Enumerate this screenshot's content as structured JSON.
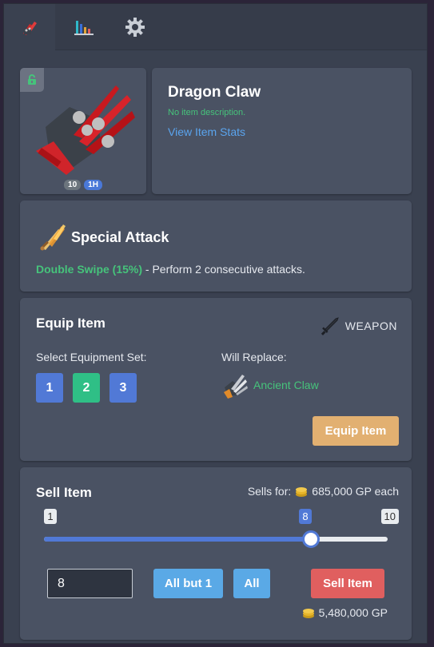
{
  "tabs": [
    {
      "name": "bank",
      "icon": "bank-icon",
      "active": true
    },
    {
      "name": "stats",
      "icon": "bar-chart-icon",
      "active": false
    },
    {
      "name": "settings",
      "icon": "gear-icon",
      "active": false
    }
  ],
  "item": {
    "name": "Dragon Claw",
    "description": "No item description.",
    "view_stats_label": "View Item Stats",
    "quantity_badge": "10",
    "hand_badge": "1H",
    "icon": "dragon-claw-icon",
    "locked": false
  },
  "special_attack": {
    "title": "Special Attack",
    "name": "Double Swipe (15%)",
    "description": " - Perform 2 consecutive attacks."
  },
  "equip": {
    "title": "Equip Item",
    "slot_type": "WEAPON",
    "select_set_label": "Select Equipment Set:",
    "sets": [
      "1",
      "2",
      "3"
    ],
    "selected_set": "2",
    "will_replace_label": "Will Replace:",
    "replace_item": "Ancient Claw",
    "equip_button": "Equip Item"
  },
  "sell": {
    "title": "Sell Item",
    "sells_for_label": "Sells for:",
    "price_each": "685,000 GP each",
    "slider_min": "1",
    "slider_max": "10",
    "slider_value": "8",
    "slider_fraction": 0.7778,
    "quantity_value": "8",
    "all_but_one_label": "All but 1",
    "all_label": "All",
    "sell_button": "Sell Item",
    "total": "5,480,000 GP"
  },
  "colors": {
    "accent_blue": "#5179d6",
    "success_green": "#46c37b",
    "warning_orange": "#e2b071",
    "danger_red": "#e05f5f",
    "info_sky": "#5aa9e6"
  }
}
